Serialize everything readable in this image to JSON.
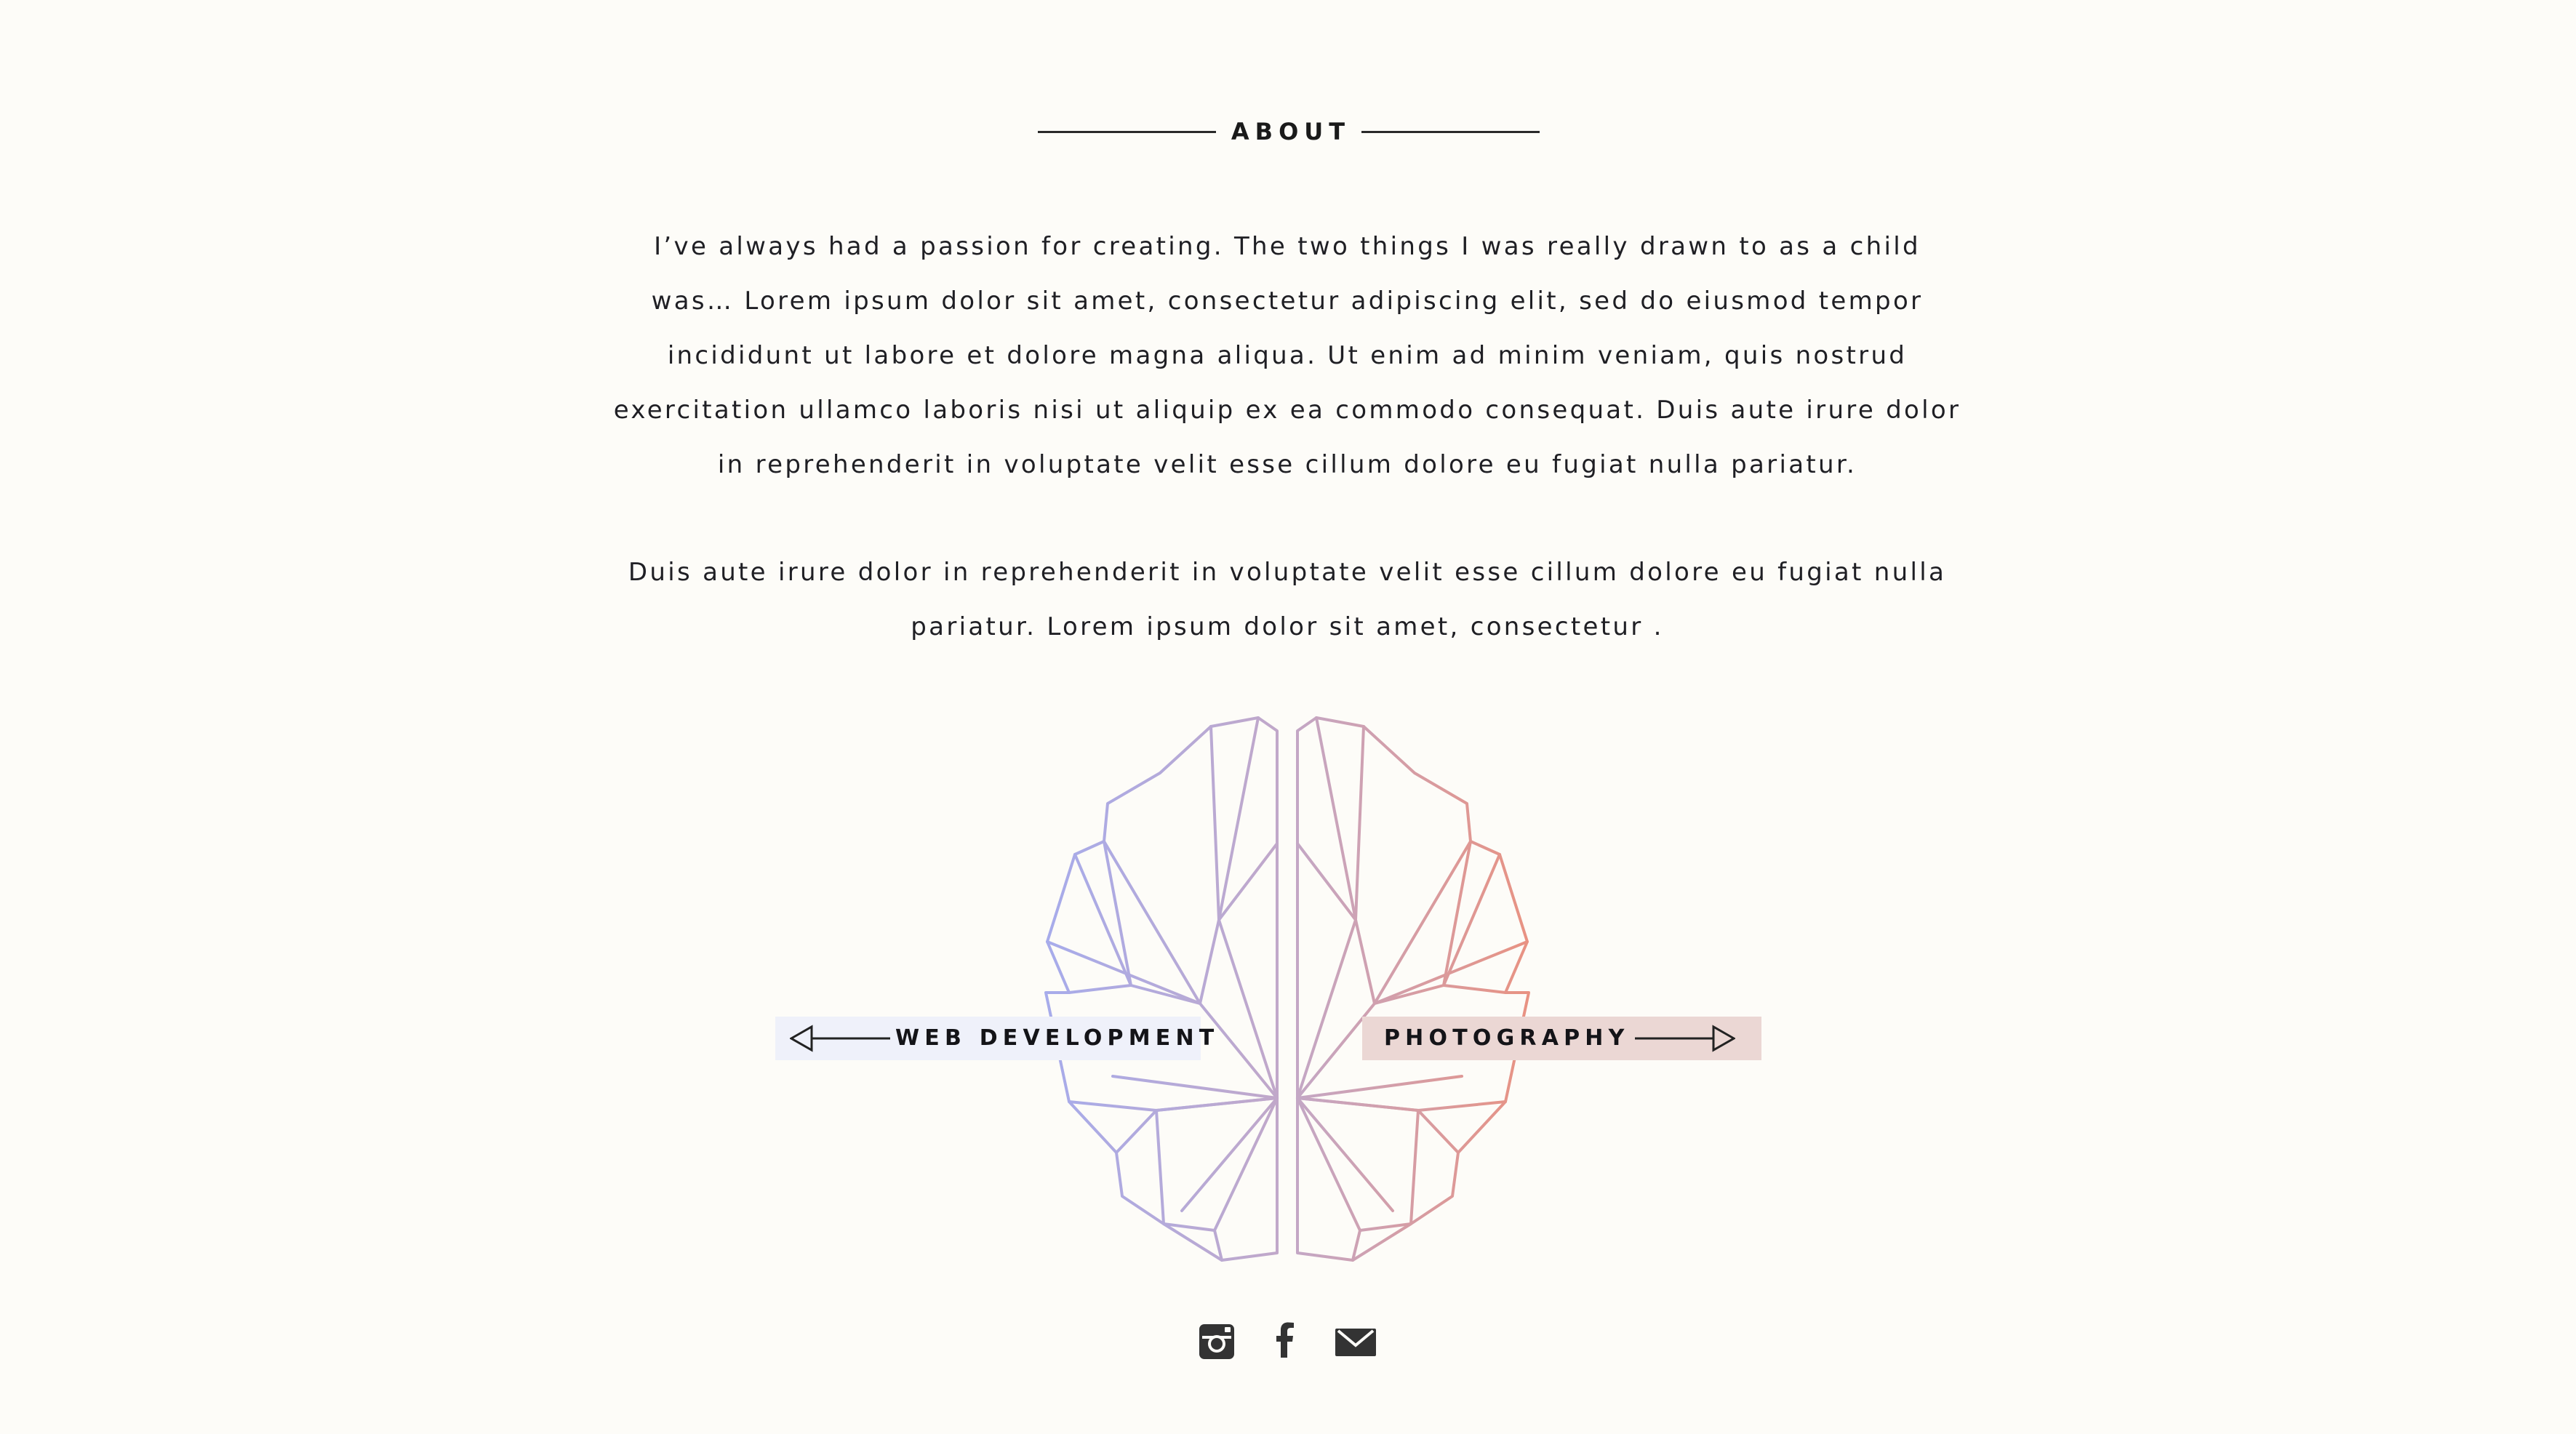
{
  "about": {
    "title": "ABOUT",
    "paragraph_1": "I’ve always had a passion for creating. The two things I was really drawn to as a child was… Lorem ipsum dolor sit amet, consectetur adipiscing elit, sed do eiusmod tempor incididunt ut labore et dolore magna aliqua. Ut enim ad minim veniam, quis nostrud exercitation ullamco laboris nisi ut aliquip ex ea commodo consequat. Duis aute irure dolor in reprehenderit in voluptate velit esse cillum dolore eu fugiat nulla pariatur.",
    "paragraph_2": "Duis aute irure dolor in reprehenderit in voluptate velit esse cillum dolore eu fugiat nulla pariatur.  Lorem ipsum dolor sit amet, consectetur ."
  },
  "nav": {
    "web_development": "WEB DEVELOPMENT",
    "photography": "PHOTOGRAPHY"
  },
  "socials": {
    "icons": [
      "instagram-icon",
      "facebook-icon",
      "mail-icon"
    ]
  },
  "colors": {
    "background": "#fdfcf8",
    "brain_left": "#a3acf0",
    "brain_middle": "#c2a8c8",
    "brain_right": "#ee8f78",
    "web_button_bg": "#eff1fa",
    "photo_button_bg": "#ebd7d4",
    "icon": "#333333"
  }
}
